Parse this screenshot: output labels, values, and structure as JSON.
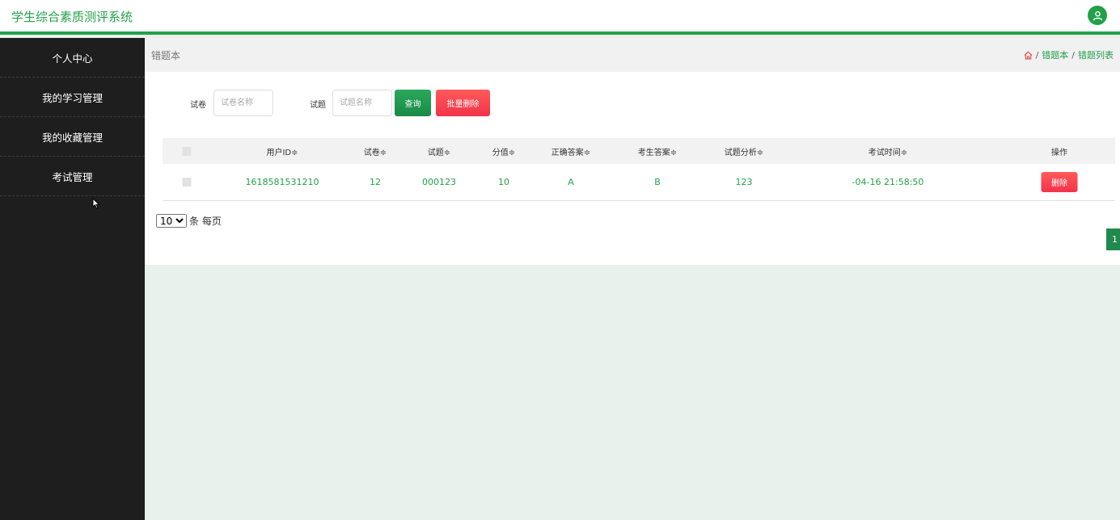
{
  "app": {
    "title": "学生综合素质测评系统"
  },
  "sidebar": {
    "items": [
      {
        "label": "个人中心"
      },
      {
        "label": "我的学习管理"
      },
      {
        "label": "我的收藏管理"
      },
      {
        "label": "考试管理"
      }
    ]
  },
  "page": {
    "title": "错题本",
    "breadcrumb": {
      "home_icon": "home-icon",
      "items": [
        "错题本",
        "错题列表"
      ],
      "separator": "/"
    }
  },
  "search": {
    "paper_label": "试卷",
    "paper_placeholder": "试卷名称",
    "question_label": "试题",
    "question_placeholder": "试题名称",
    "query_button": "查询",
    "batch_delete_button": "批量删除"
  },
  "table": {
    "headers": [
      "用户ID≑",
      "试卷≑",
      "试题≑",
      "分值≑",
      "正确答案≑",
      "考生答案≑",
      "试题分析≑",
      "考试时间≑",
      "操作"
    ],
    "rows": [
      {
        "user_id": "1618581531210",
        "paper": "12",
        "question": "000123",
        "score": "10",
        "correct": "A",
        "answer": "B",
        "analysis": "123",
        "time": "-04-16 21:58:50",
        "action": "删除"
      }
    ]
  },
  "pagination": {
    "page_size": "10",
    "page_size_options": [
      "10"
    ],
    "per_page_label": "条 每页",
    "current_page": "1"
  },
  "colors": {
    "primary": "#23a04a",
    "danger": "#f3334a",
    "sidebar": "#1e1e1f",
    "background": "#e8f1ec"
  }
}
